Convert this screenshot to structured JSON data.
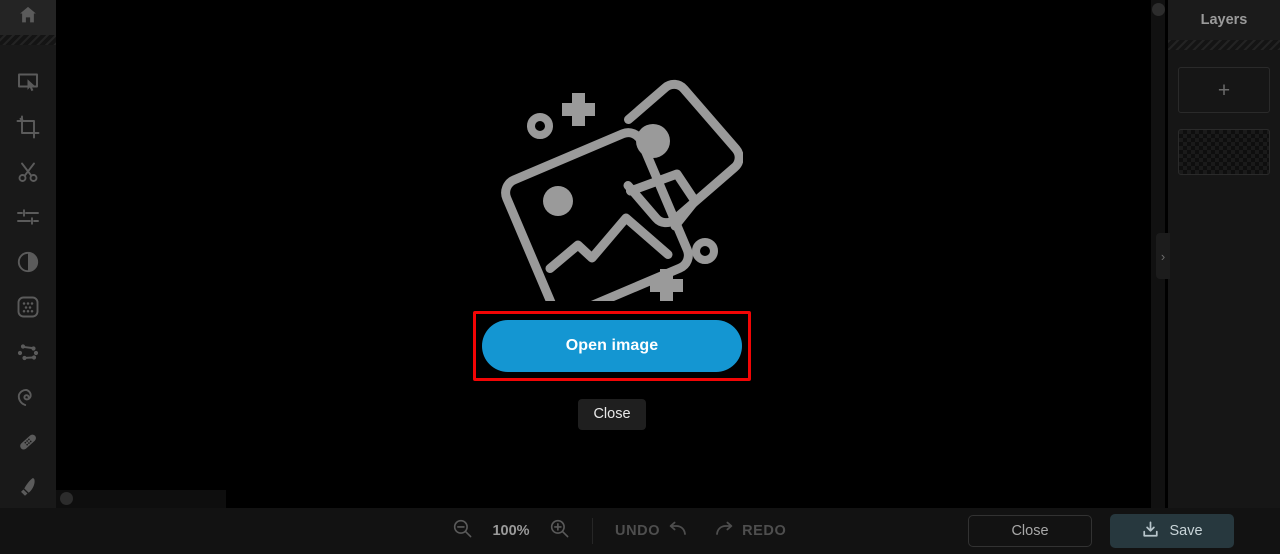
{
  "app": {
    "background": "#0b0b0b",
    "accent": "#1496d2",
    "highlight": "#f20505"
  },
  "tool_rail": {
    "home": {
      "label": "Home",
      "icon": "home-icon"
    },
    "tools": [
      {
        "name": "select-tool",
        "icon": "marquee-select-icon"
      },
      {
        "name": "crop-tool",
        "icon": "crop-icon"
      },
      {
        "name": "cut-tool",
        "icon": "scissors-icon"
      },
      {
        "name": "adjust-tool",
        "icon": "sliders-icon"
      },
      {
        "name": "contrast-tool",
        "icon": "contrast-circle-icon"
      },
      {
        "name": "texture-tool",
        "icon": "dotted-square-icon"
      },
      {
        "name": "curves-tool",
        "icon": "nodes-icon"
      },
      {
        "name": "smudge-tool",
        "icon": "spiral-icon"
      },
      {
        "name": "heal-tool",
        "icon": "bandage-icon"
      },
      {
        "name": "brush-tool",
        "icon": "brush-icon"
      },
      {
        "name": "text-tool",
        "icon": "text-t-icon"
      }
    ]
  },
  "canvas": {
    "placeholder_icon": "two-photos-icon",
    "open_image_label": "Open image",
    "close_label": "Close",
    "highlighted_element": "open-image-button"
  },
  "layers": {
    "title": "Layers",
    "add_layer_glyph": "+",
    "collapse_glyph": "›",
    "items": [
      {
        "name": "layer-thumbnail",
        "content": "transparent-checkerboard"
      }
    ]
  },
  "bottom_bar": {
    "zoom_out_icon": "zoom-out-icon",
    "zoom_level": "100%",
    "zoom_in_icon": "zoom-in-icon",
    "undo_label": "UNDO",
    "redo_label": "REDO",
    "close_label": "Close",
    "save_label": "Save",
    "save_icon": "download-icon"
  }
}
